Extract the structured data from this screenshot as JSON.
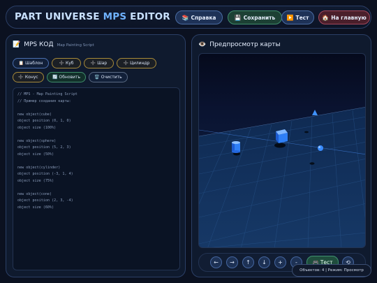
{
  "app": {
    "title_main": "PART UNIVERSE ",
    "title_accent": "MPS",
    "title_end": " EDITOR"
  },
  "header_buttons": {
    "help": {
      "icon": "📚",
      "label": "Справка"
    },
    "save": {
      "icon": "💾",
      "label": "Сохранить"
    },
    "test": {
      "icon": "▶️",
      "label": "Тест"
    },
    "home": {
      "icon": "🏠",
      "label": "На главную"
    }
  },
  "editor": {
    "icon": "📝",
    "title": "MPS КОД",
    "subtitle": "Map Painting Script",
    "tools": {
      "template": {
        "icon": "📋",
        "label": "Шаблон"
      },
      "cube": {
        "icon": "➕",
        "label": "Куб"
      },
      "sphere": {
        "icon": "➕",
        "label": "Шар"
      },
      "cylinder": {
        "icon": "➕",
        "label": "Цилиндр"
      },
      "cone": {
        "icon": "➕",
        "label": "Конус"
      },
      "refresh": {
        "icon": "🔄",
        "label": "Обновить"
      },
      "clear": {
        "icon": "🗑️",
        "label": "Очистить"
      }
    },
    "code": "// MPS - Map Painting Script\n// Пример создания карты:\n\nnew object(cube)\nobject position (0, 1, 0)\nobject size (100%)\n\nnew object(sphere)\nobject position (5, 2, 3)\nobject size (50%)\n\nnew object(cylinder)\nobject position (-3, 1, 4)\nobject size (75%)\n\nnew object(cone)\nobject position (2, 3, -4)\nobject size (60%)"
  },
  "preview": {
    "icon": "👁️",
    "title": "Предпросмотр карты",
    "controls": {
      "left": "←",
      "right": "→",
      "up": "↑",
      "down": "↓",
      "zoom_in": "+",
      "zoom_out": "-",
      "test_icon": "🎮",
      "test_label": "Тест",
      "reset": "⟲"
    }
  },
  "status": "Объектов: 4 | Режим: Просмотр",
  "colors": {
    "accent": "#6fb2ff",
    "object_blue": "#2f7ff5"
  }
}
